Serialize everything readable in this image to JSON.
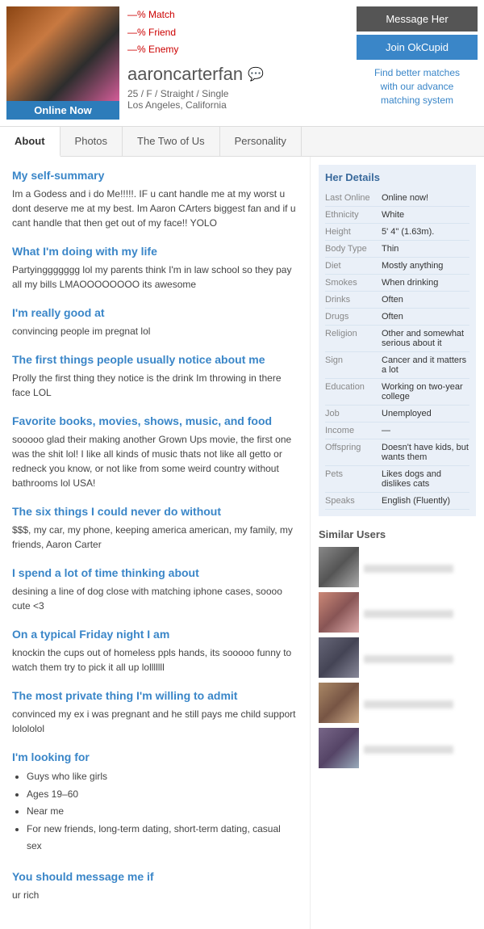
{
  "header": {
    "match_percent": "—%",
    "friend_percent": "—%",
    "enemy_percent": "—%",
    "match_label": "Match",
    "friend_label": "Friend",
    "enemy_label": "Enemy",
    "username": "aaroncarterfan",
    "age": "25",
    "gender": "F",
    "orientation": "Straight",
    "status": "Single",
    "location": "Los Angeles, California",
    "online_badge": "Online Now",
    "btn_message": "Message Her",
    "btn_join": "Join OkCupid",
    "find_better_line1": "Find better",
    "find_better_line2": "matches",
    "find_better_line3": "with our advance",
    "find_better_line4": "matching system"
  },
  "tabs": [
    "About",
    "Photos",
    "The Two of Us",
    "Personality"
  ],
  "sections": [
    {
      "id": "self-summary",
      "title": "My self-summary",
      "body": "Im a Godess and i do Me!!!!!. IF u cant handle me at my worst u dont deserve me at my best. Im Aaron CArters biggest fan and if u cant handle that then get out of my face!! YOLO"
    },
    {
      "id": "doing-with-life",
      "title": "What I'm doing with my life",
      "body": "Partyinggggggg lol my parents think I'm in law school so they pay all my bills LMAOOOOOOOO its awesome"
    },
    {
      "id": "really-good-at",
      "title": "I'm really good at",
      "body": "convincing people im pregnat lol"
    },
    {
      "id": "first-notice",
      "title": "The first things people usually notice about me",
      "body": "Prolly the first thing they notice is the drink Im throwing in there face LOL"
    },
    {
      "id": "favorite-things",
      "title": "Favorite books, movies, shows, music, and food",
      "body": "sooooo glad their making another Grown Ups movie, the first one was the shit lol! I like all kinds of music thats not like all getto or redneck you know, or not like from some weird country without bathrooms lol USA!"
    },
    {
      "id": "six-things",
      "title": "The six things I could never do without",
      "body": "$$$, my car, my phone, keeping america american, my family, my friends, Aaron Carter"
    },
    {
      "id": "thinking-about",
      "title": "I spend a lot of time thinking about",
      "body": "desining a line of dog close with matching iphone cases, soooo cute <3"
    },
    {
      "id": "friday-night",
      "title": "On a typical Friday night I am",
      "body": "knockin the cups out of homeless ppls hands, its sooooo funny to watch them try to pick it all up lolllllll"
    },
    {
      "id": "private-thing",
      "title": "The most private thing I'm willing to admit",
      "body": "convinced my ex i was pregnant and he still pays me child support lolololol"
    },
    {
      "id": "looking-for",
      "title": "I'm looking for",
      "list": [
        "Guys who like girls",
        "Ages 19–60",
        "Near me",
        "For new friends, long-term dating, short-term dating, casual sex"
      ]
    },
    {
      "id": "message-me",
      "title": "You should message me if",
      "body": "ur rich"
    }
  ],
  "details": {
    "heading": "Her Details",
    "rows": [
      {
        "label": "Last Online",
        "value": "Online now!"
      },
      {
        "label": "Ethnicity",
        "value": "White"
      },
      {
        "label": "Height",
        "value": "5' 4\" (1.63m)."
      },
      {
        "label": "Body Type",
        "value": "Thin"
      },
      {
        "label": "Diet",
        "value": "Mostly anything"
      },
      {
        "label": "Smokes",
        "value": "When drinking"
      },
      {
        "label": "Drinks",
        "value": "Often"
      },
      {
        "label": "Drugs",
        "value": "Often"
      },
      {
        "label": "Religion",
        "value": "Other and somewhat serious about it"
      },
      {
        "label": "Sign",
        "value": "Cancer and it matters a lot"
      },
      {
        "label": "Education",
        "value": "Working on two-year college"
      },
      {
        "label": "Job",
        "value": "Unemployed"
      },
      {
        "label": "Income",
        "value": "—"
      },
      {
        "label": "Offspring",
        "value": "Doesn't have kids, but wants them"
      },
      {
        "label": "Pets",
        "value": "Likes dogs and dislikes cats"
      },
      {
        "label": "Speaks",
        "value": "English (Fluently)"
      }
    ]
  },
  "similar_users": {
    "heading": "Similar Users",
    "count": 5
  }
}
